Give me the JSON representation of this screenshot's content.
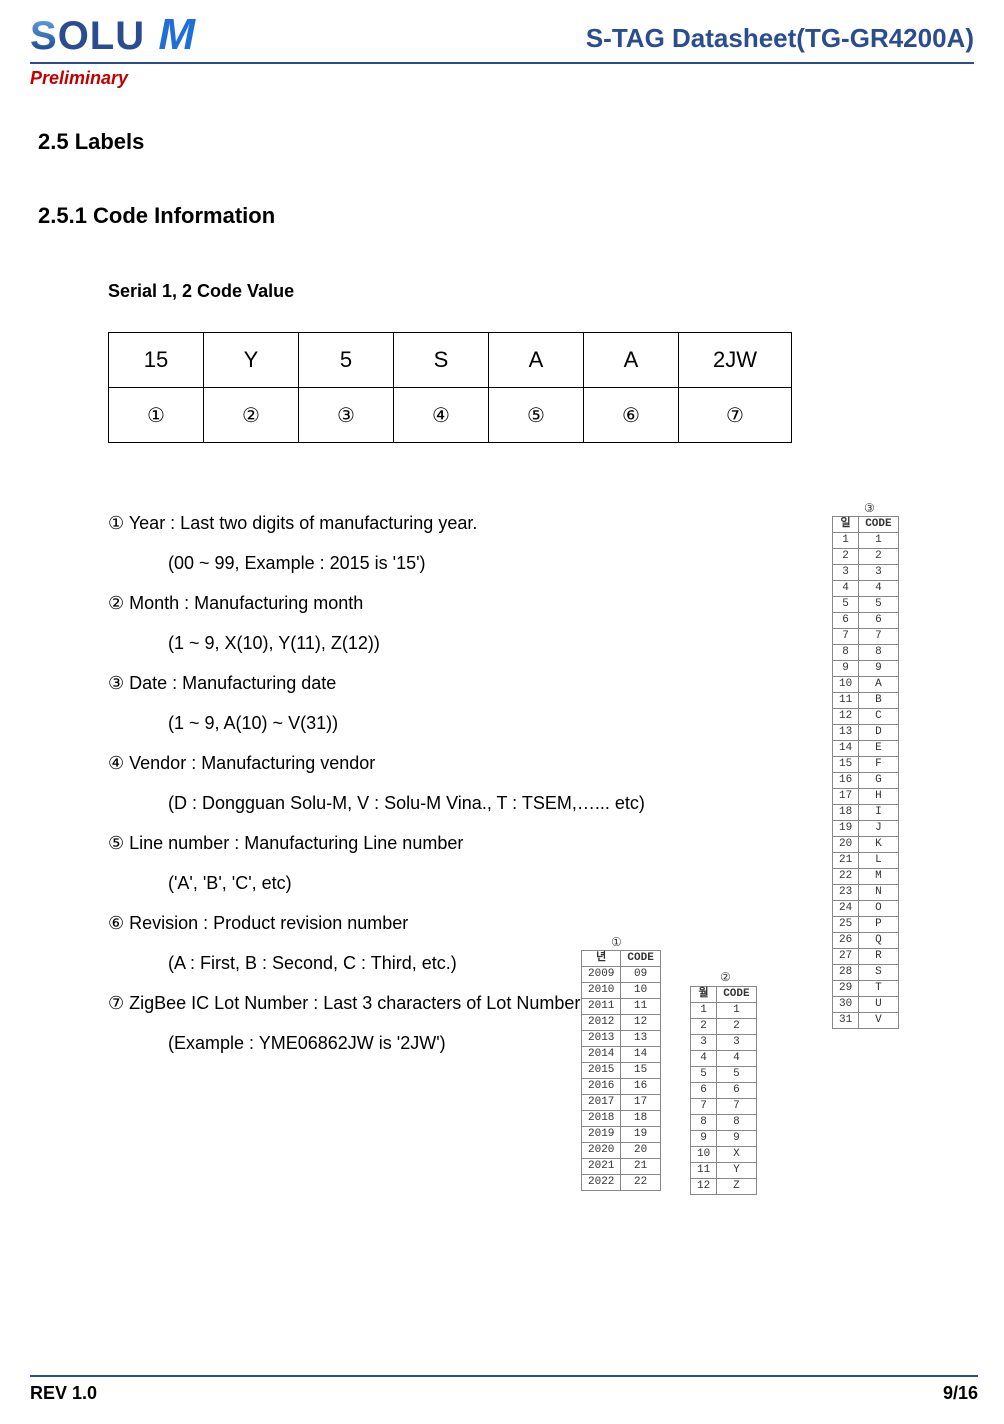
{
  "header": {
    "logo_text_1": "S",
    "logo_text_2": "OLU",
    "logo_text_3": " M",
    "title": "S-TAG Datasheet(TG-GR4200A)",
    "preliminary": "Preliminary"
  },
  "sections": {
    "s25": "2.5 Labels",
    "s251": "2.5.1 Code Information",
    "serial_caption": "Serial 1, 2 Code Value"
  },
  "serial": {
    "row1": [
      "15",
      "Y",
      "5",
      "S",
      "A",
      "A",
      "2JW"
    ],
    "row2": [
      "①",
      "②",
      "③",
      "④",
      "⑤",
      "⑥",
      "⑦"
    ]
  },
  "definitions": {
    "d1": "① Year : Last two digits of manufacturing year.",
    "d1s": "(00 ~ 99, Example : 2015 is '15')",
    "d2": "② Month : Manufacturing month",
    "d2s": "(1 ~ 9, X(10), Y(11), Z(12))",
    "d3": "③ Date : Manufacturing date",
    "d3s": "(1 ~ 9, A(10) ~ V(31))",
    "d4": "④ Vendor : Manufacturing vendor",
    "d4s": "(D : Dongguan Solu-M, V : Solu-M Vina., T : TSEM,…... etc)",
    "d5": "⑤ Line number : Manufacturing Line number",
    "d5s": "('A', 'B', 'C', etc)",
    "d6": "⑥ Revision : Product revision number",
    "d6s": "(A : First, B : Second, C : Third, etc.)",
    "d7": "⑦ ZigBee IC Lot Number : Last 3 characters of Lot Number",
    "d7s": "(Example : YME06862JW is '2JW')"
  },
  "footer": {
    "rev": "REV 1.0",
    "page": "9/16"
  },
  "mini_tables": {
    "cap1": "①",
    "t1_headers": [
      "년",
      "CODE"
    ],
    "t1_rows": [
      [
        "2009",
        "09"
      ],
      [
        "2010",
        "10"
      ],
      [
        "2011",
        "11"
      ],
      [
        "2012",
        "12"
      ],
      [
        "2013",
        "13"
      ],
      [
        "2014",
        "14"
      ],
      [
        "2015",
        "15"
      ],
      [
        "2016",
        "16"
      ],
      [
        "2017",
        "17"
      ],
      [
        "2018",
        "18"
      ],
      [
        "2019",
        "19"
      ],
      [
        "2020",
        "20"
      ],
      [
        "2021",
        "21"
      ],
      [
        "2022",
        "22"
      ]
    ],
    "cap2": "②",
    "t2_headers": [
      "월",
      "CODE"
    ],
    "t2_rows": [
      [
        "1",
        "1"
      ],
      [
        "2",
        "2"
      ],
      [
        "3",
        "3"
      ],
      [
        "4",
        "4"
      ],
      [
        "5",
        "5"
      ],
      [
        "6",
        "6"
      ],
      [
        "7",
        "7"
      ],
      [
        "8",
        "8"
      ],
      [
        "9",
        "9"
      ],
      [
        "10",
        "X"
      ],
      [
        "11",
        "Y"
      ],
      [
        "12",
        "Z"
      ]
    ],
    "cap3": "③",
    "t3_headers": [
      "일",
      "CODE"
    ],
    "t3_rows": [
      [
        "1",
        "1"
      ],
      [
        "2",
        "2"
      ],
      [
        "3",
        "3"
      ],
      [
        "4",
        "4"
      ],
      [
        "5",
        "5"
      ],
      [
        "6",
        "6"
      ],
      [
        "7",
        "7"
      ],
      [
        "8",
        "8"
      ],
      [
        "9",
        "9"
      ],
      [
        "10",
        "A"
      ],
      [
        "11",
        "B"
      ],
      [
        "12",
        "C"
      ],
      [
        "13",
        "D"
      ],
      [
        "14",
        "E"
      ],
      [
        "15",
        "F"
      ],
      [
        "16",
        "G"
      ],
      [
        "17",
        "H"
      ],
      [
        "18",
        "I"
      ],
      [
        "19",
        "J"
      ],
      [
        "20",
        "K"
      ],
      [
        "21",
        "L"
      ],
      [
        "22",
        "M"
      ],
      [
        "23",
        "N"
      ],
      [
        "24",
        "O"
      ],
      [
        "25",
        "P"
      ],
      [
        "26",
        "Q"
      ],
      [
        "27",
        "R"
      ],
      [
        "28",
        "S"
      ],
      [
        "29",
        "T"
      ],
      [
        "30",
        "U"
      ],
      [
        "31",
        "V"
      ]
    ]
  }
}
